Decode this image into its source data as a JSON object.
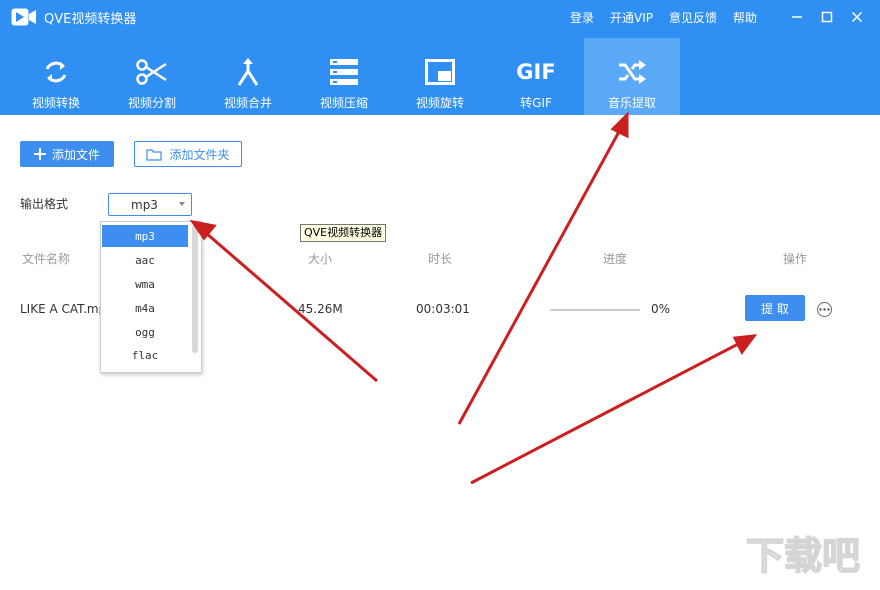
{
  "titlebar": {
    "app_title": "QVE视频转换器",
    "links": [
      "登录",
      "开通VIP",
      "意见反馈",
      "帮助"
    ]
  },
  "tabs": [
    {
      "label": "视频转换",
      "icon": "convert-icon",
      "active": false
    },
    {
      "label": "视频分割",
      "icon": "scissors-icon",
      "active": false
    },
    {
      "label": "视频合并",
      "icon": "merge-icon",
      "active": false
    },
    {
      "label": "视频压缩",
      "icon": "compress-icon",
      "active": false
    },
    {
      "label": "视频旋转",
      "icon": "rotate-icon",
      "active": false
    },
    {
      "label": "转GIF",
      "icon": "gif-icon",
      "icon_text": "GIF",
      "active": false
    },
    {
      "label": "音乐提取",
      "icon": "shuffle-icon",
      "active": true
    }
  ],
  "toolbar": {
    "add_file_label": "添加文件",
    "add_folder_label": "添加文件夹"
  },
  "format": {
    "label": "输出格式",
    "selected": "mp3",
    "options": [
      "mp3",
      "aac",
      "wma",
      "m4a",
      "ogg",
      "flac"
    ]
  },
  "tooltip": "QVE视频转换器",
  "table": {
    "headers": {
      "name": "文件名称",
      "size": "大小",
      "duration": "时长",
      "progress": "进度",
      "action": "操作"
    },
    "rows": [
      {
        "name": "LIKE A CAT.mp",
        "size": "45.26M",
        "duration": "00:03:01",
        "progress_text": "0%",
        "progress": 0,
        "action_label": "提 取"
      }
    ]
  },
  "watermark": "下载吧",
  "colors": {
    "header": "#2f8ff3",
    "active_tab": "#5aa8f6",
    "primary": "#3d8eee",
    "annotation_arrow": "#cc1f1f"
  }
}
